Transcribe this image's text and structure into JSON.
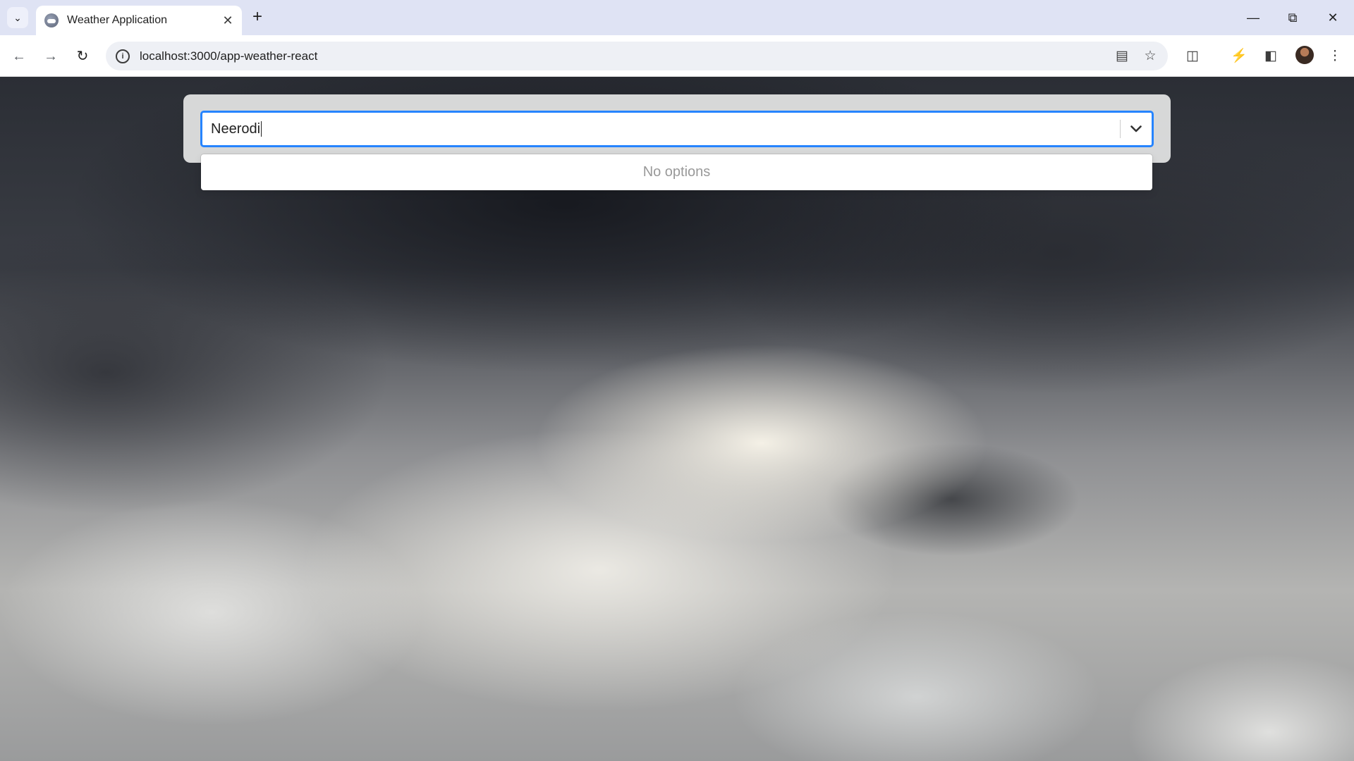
{
  "browser": {
    "tab_title": "Weather Application",
    "url": "localhost:3000/app-weather-react",
    "new_tab_symbol": "+",
    "icons": [
      "tab-search-icon",
      "back-icon",
      "forward-icon",
      "reload-icon",
      "site-info-icon",
      "translate-icon",
      "bookmark-star-icon",
      "extensions-icon",
      "performance-icon",
      "side-panel-icon",
      "profile-avatar",
      "menu-kebab-icon",
      "minimize-icon",
      "restore-icon",
      "close-icon"
    ]
  },
  "search": {
    "value": "Neerodi",
    "chevron_icon": "chevron-down-icon"
  },
  "dropdown": {
    "no_options_text": "No options"
  },
  "colors": {
    "focus_border": "#2684ff",
    "tabstrip": "#dfe3f4",
    "card_bg": "#dddede"
  }
}
